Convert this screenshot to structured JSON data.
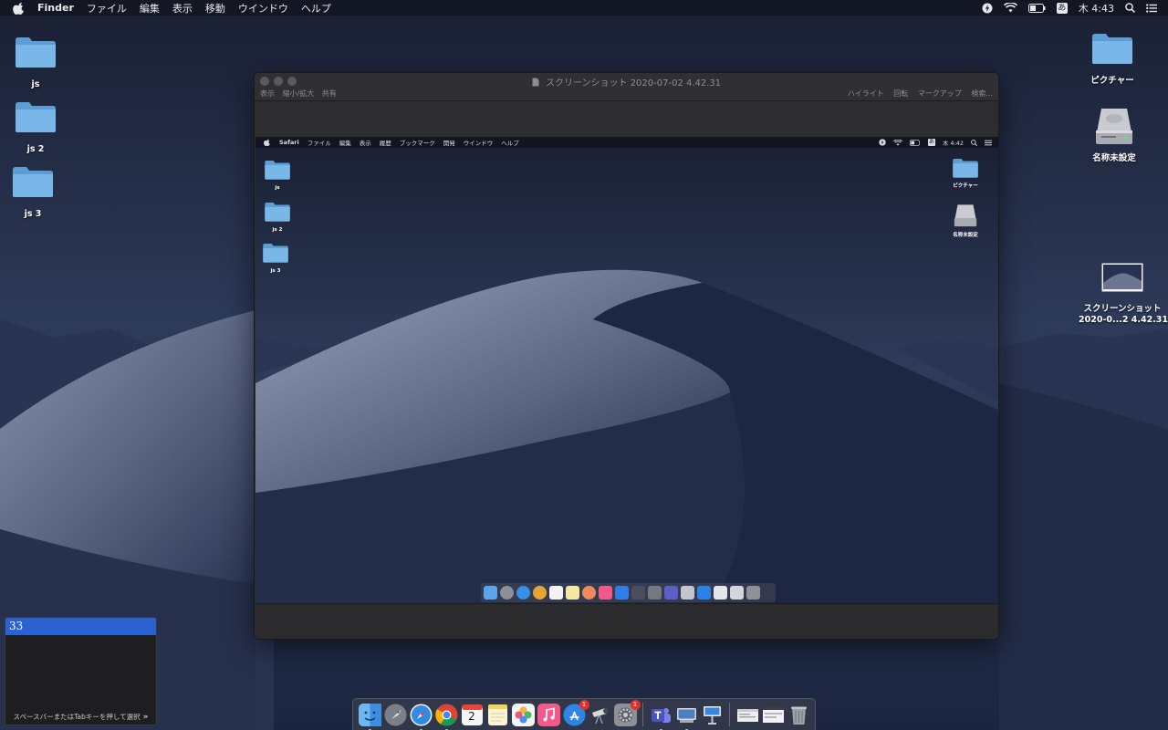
{
  "menubar": {
    "app": "Finder",
    "items": [
      "ファイル",
      "編集",
      "表示",
      "移動",
      "ウインドウ",
      "ヘルプ"
    ],
    "ime_indicator": "あ",
    "clock": "木 4:43"
  },
  "desktop": {
    "left_icons": [
      {
        "label": "js"
      },
      {
        "label": "js 2"
      },
      {
        "label": "js 3"
      }
    ],
    "right_icons": {
      "pictures": "ピクチャー",
      "disk": "名称未設定",
      "screenshot_line1": "スクリーンショット",
      "screenshot_line2": "2020-0...2 4.42.31"
    }
  },
  "preview_window": {
    "title": "スクリーンショット 2020-07-02 4.42.31",
    "toolbar_left": [
      "表示",
      "縮小/拡大",
      "共有"
    ],
    "toolbar_right": [
      "ハイライト",
      "回転",
      "マークアップ",
      "検索..."
    ]
  },
  "inner_screenshot": {
    "menubar": {
      "app": "Safari",
      "items": [
        "ファイル",
        "編集",
        "表示",
        "履歴",
        "ブックマーク",
        "開発",
        "ウインドウ",
        "ヘルプ"
      ],
      "ime_indicator": "あ",
      "clock": "木 4:42"
    },
    "left_icons": [
      "js",
      "js 2",
      "js 3"
    ],
    "right_icons": [
      "ピクチャー",
      "名称未設定"
    ]
  },
  "ime_panel": {
    "candidate": "33",
    "hint": "スペースバーまたはTabキーを押して選択",
    "arrow": "»"
  },
  "dock": {
    "calendar_day": "2",
    "app_store_badge": "1",
    "system_prefs_badge": "1"
  },
  "colors": {
    "accent": "#2a62d2",
    "folder": "#6aaee3",
    "badge": "#e0322c"
  }
}
